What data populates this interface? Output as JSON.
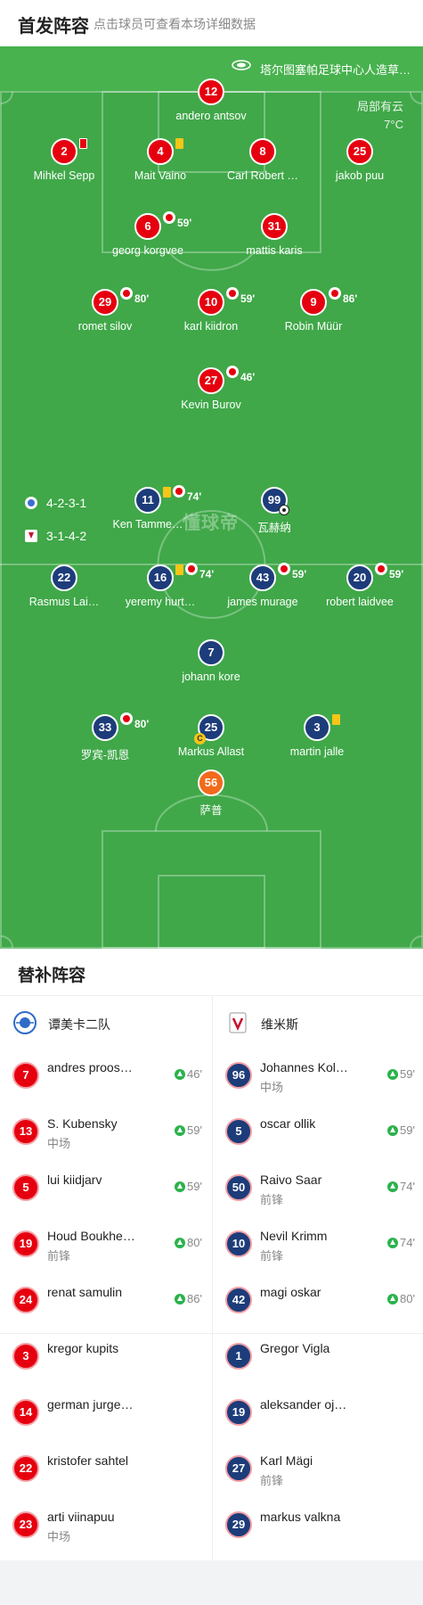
{
  "header": {
    "title": "首发阵容",
    "subtitle": "点击球员可查看本场详细数据"
  },
  "pitch": {
    "stadium": "塔尔图塞帕足球中心人造草…",
    "weather": "局部有云",
    "temperature": "7°C",
    "watermark": "懂球帝",
    "home_formation": "4-2-3-1",
    "away_formation": "3-1-4-2"
  },
  "home_players": [
    {
      "number": "12",
      "name": "andero antsov"
    },
    {
      "number": "2",
      "name": "Mihkel Sepp",
      "card": "red"
    },
    {
      "number": "4",
      "name": "Mait Vaino",
      "card": "yellow"
    },
    {
      "number": "8",
      "name": "Carl Robert …"
    },
    {
      "number": "25",
      "name": "jakob puu"
    },
    {
      "number": "6",
      "name": "georg korgvee",
      "sub": "59'"
    },
    {
      "number": "31",
      "name": "mattis karis"
    },
    {
      "number": "29",
      "name": "romet silov",
      "sub": "80'"
    },
    {
      "number": "10",
      "name": "karl kiidron",
      "sub": "59'"
    },
    {
      "number": "9",
      "name": "Robin Müür",
      "sub": "86'"
    },
    {
      "number": "27",
      "name": "Kevin Burov",
      "sub": "46'"
    }
  ],
  "away_players": [
    {
      "number": "11",
      "name": "Ken Tamme…",
      "card": "yellow",
      "sub": "74'"
    },
    {
      "number": "99",
      "name": "瓦赫纳",
      "goal": "ball"
    },
    {
      "number": "22",
      "name": "Rasmus Lai…"
    },
    {
      "number": "16",
      "name": "yeremy hurt…",
      "card": "yellow",
      "sub": "74'"
    },
    {
      "number": "43",
      "name": "james murage",
      "sub": "59'"
    },
    {
      "number": "20",
      "name": "robert laidvee",
      "sub": "59'"
    },
    {
      "number": "7",
      "name": "johann kore"
    },
    {
      "number": "33",
      "name": "罗宾-凯恩",
      "sub": "80'"
    },
    {
      "number": "25",
      "name": "Markus Allast",
      "captain": "C"
    },
    {
      "number": "3",
      "name": "martin jalle",
      "card": "yellow"
    },
    {
      "number": "56",
      "name": "萨普"
    }
  ],
  "subs": {
    "title": "替补阵容",
    "home_team": "谭美卡二队",
    "away_team": "维米斯",
    "home": [
      {
        "number": "7",
        "name": "andres proos…",
        "position": "",
        "time": "46'"
      },
      {
        "number": "13",
        "name": "S. Kubensky",
        "position": "中场",
        "time": "59'"
      },
      {
        "number": "5",
        "name": "lui kiidjarv",
        "position": "",
        "time": "59'"
      },
      {
        "number": "19",
        "name": "Houd Boukhe…",
        "position": "前锋",
        "time": "80'"
      },
      {
        "number": "24",
        "name": "renat samulin",
        "position": "",
        "time": "86'"
      },
      {
        "number": "3",
        "name": "kregor kupits",
        "position": "",
        "time": ""
      },
      {
        "number": "14",
        "name": "german jurge…",
        "position": "",
        "time": ""
      },
      {
        "number": "22",
        "name": "kristofer sahtel",
        "position": "",
        "time": ""
      },
      {
        "number": "23",
        "name": "arti viinapuu",
        "position": "中场",
        "time": ""
      }
    ],
    "away": [
      {
        "number": "96",
        "name": "Johannes Kol…",
        "position": "中场",
        "time": "59'"
      },
      {
        "number": "5",
        "name": "oscar ollik",
        "position": "",
        "time": "59'"
      },
      {
        "number": "50",
        "name": "Raivo Saar",
        "position": "前锋",
        "time": "74'"
      },
      {
        "number": "10",
        "name": "Nevil Krimm",
        "position": "前锋",
        "time": "74'"
      },
      {
        "number": "42",
        "name": "magi oskar",
        "position": "",
        "time": "80'"
      },
      {
        "number": "1",
        "name": "Gregor Vigla",
        "position": "",
        "time": ""
      },
      {
        "number": "19",
        "name": "aleksander oj…",
        "position": "",
        "time": ""
      },
      {
        "number": "27",
        "name": "Karl Mägi",
        "position": "前锋",
        "time": ""
      },
      {
        "number": "29",
        "name": "markus valkna",
        "position": "",
        "time": ""
      }
    ]
  }
}
